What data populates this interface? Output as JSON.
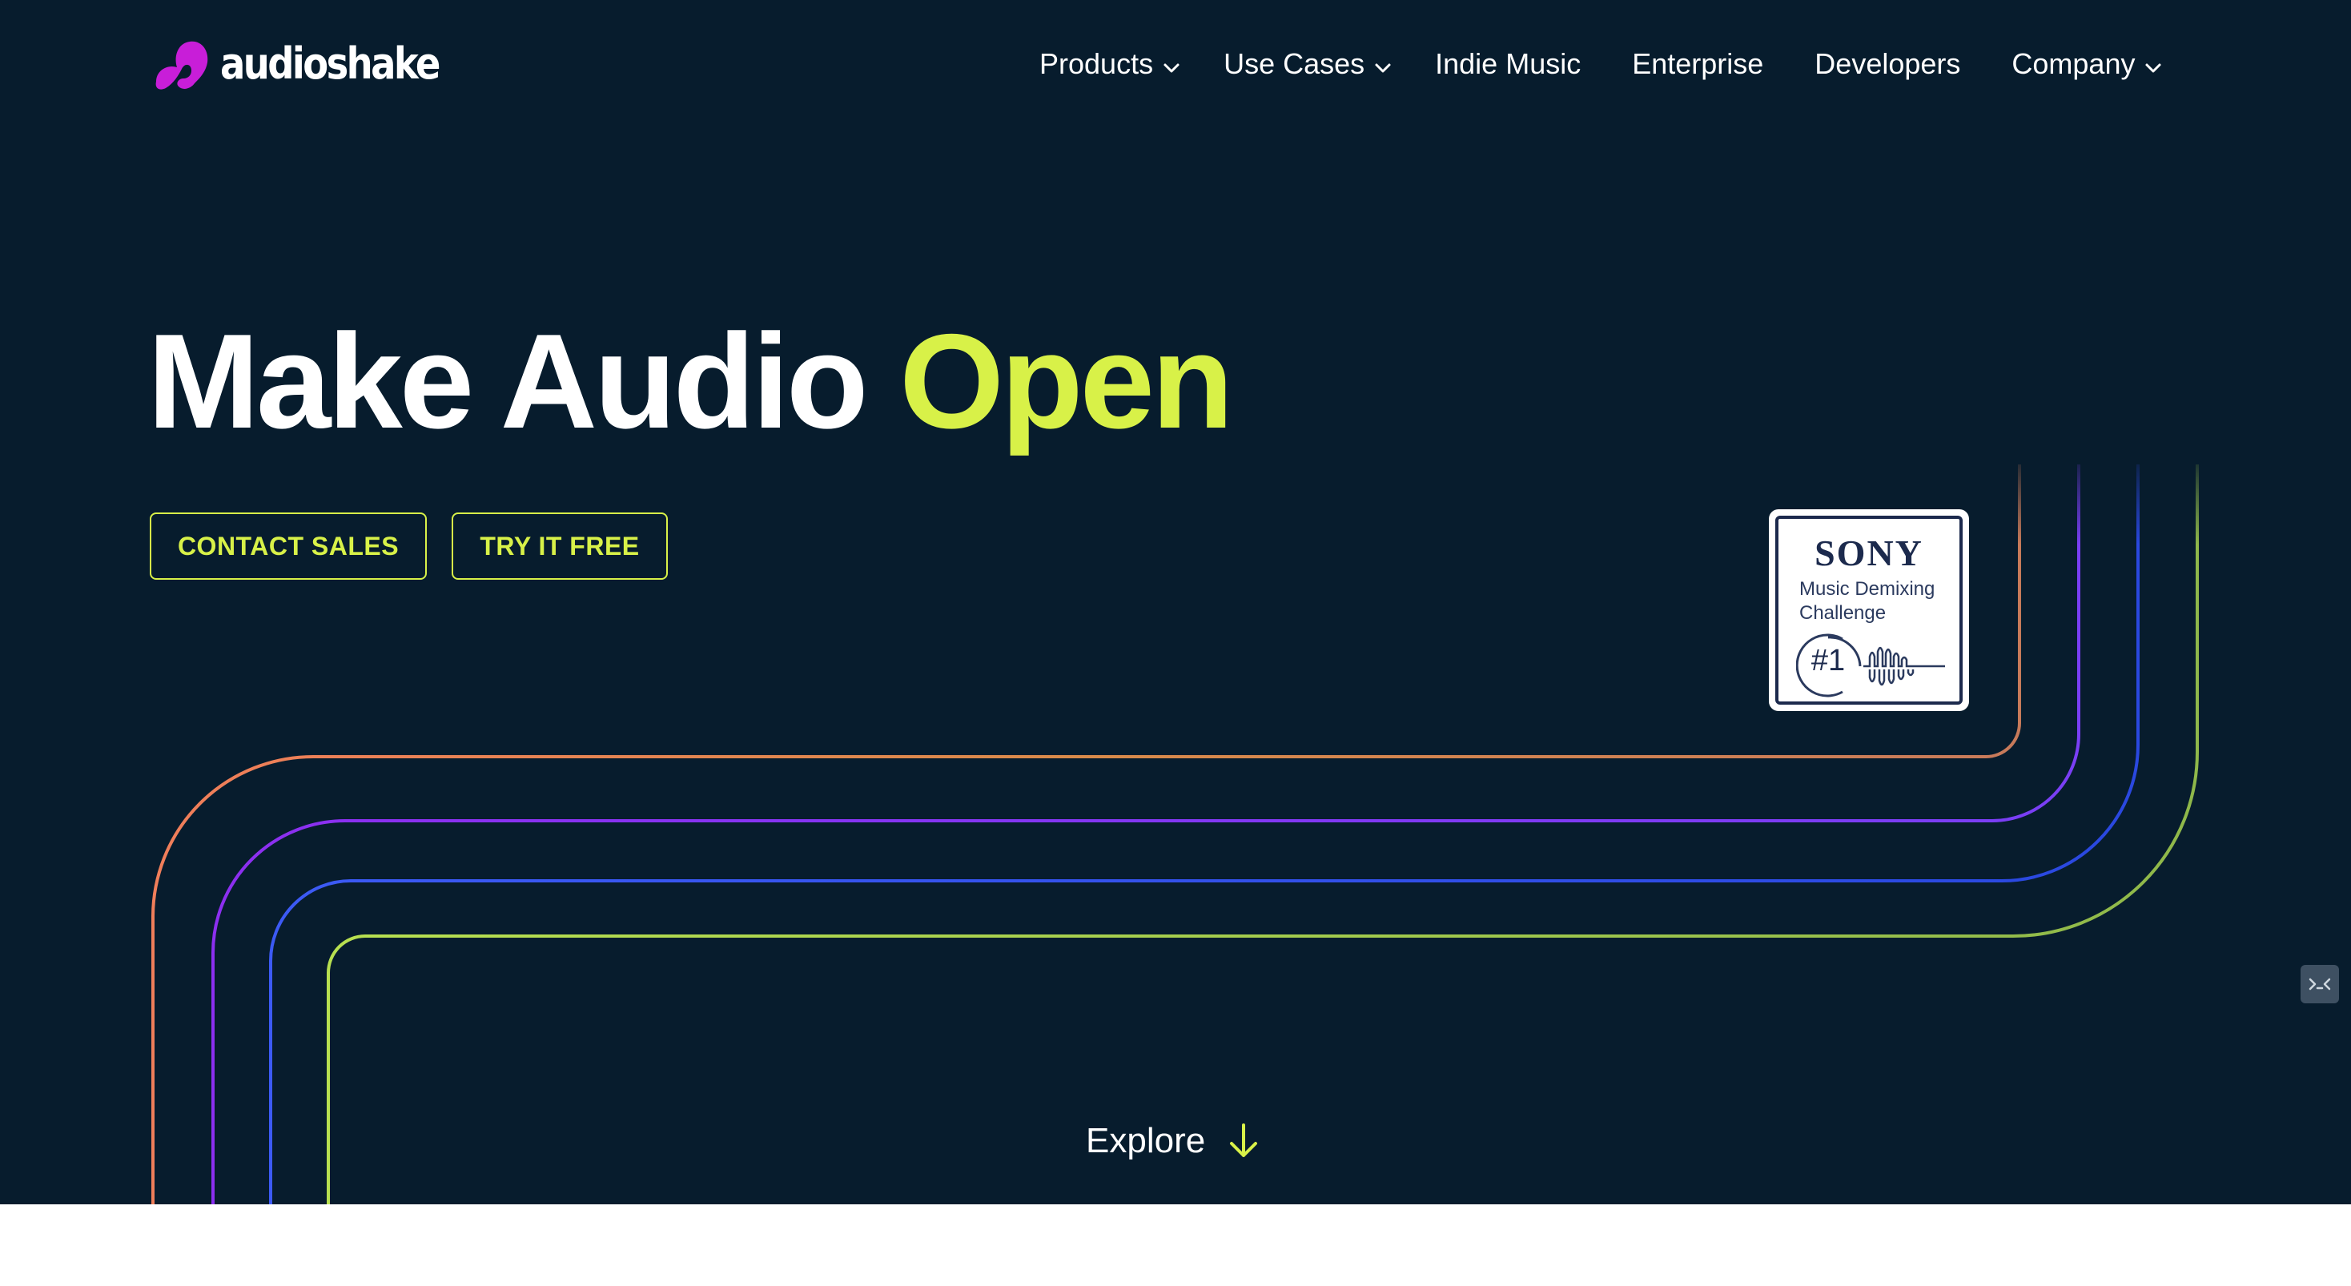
{
  "brand": {
    "name": "audioshake"
  },
  "nav": {
    "items": [
      {
        "label": "Products",
        "has_dropdown": true
      },
      {
        "label": "Use Cases",
        "has_dropdown": true
      },
      {
        "label": "Indie Music",
        "has_dropdown": false
      },
      {
        "label": "Enterprise",
        "has_dropdown": false
      },
      {
        "label": "Developers",
        "has_dropdown": false
      },
      {
        "label": "Company",
        "has_dropdown": true
      }
    ]
  },
  "hero": {
    "headline_main": "Make Audio ",
    "headline_accent": "Open",
    "buttons": {
      "contact_sales": "CONTACT SALES",
      "try_free": "TRY IT FREE"
    },
    "badge": {
      "brand": "SONY",
      "line1": "Music Demixing",
      "line2": "Challenge",
      "rank": "#1"
    },
    "explore_label": "Explore"
  },
  "colors": {
    "background": "#071c2d",
    "accent": "#d8f148",
    "logo": "#c81ed8",
    "line_orange": "#e28a5a",
    "line_purple": "#8a3bf0",
    "line_blue": "#3a4ff0",
    "line_green": "#a9d24a"
  },
  "icons": {
    "dropdown": "chevron-down-icon",
    "explore": "arrow-down-icon",
    "widget": "terminal-icon"
  }
}
